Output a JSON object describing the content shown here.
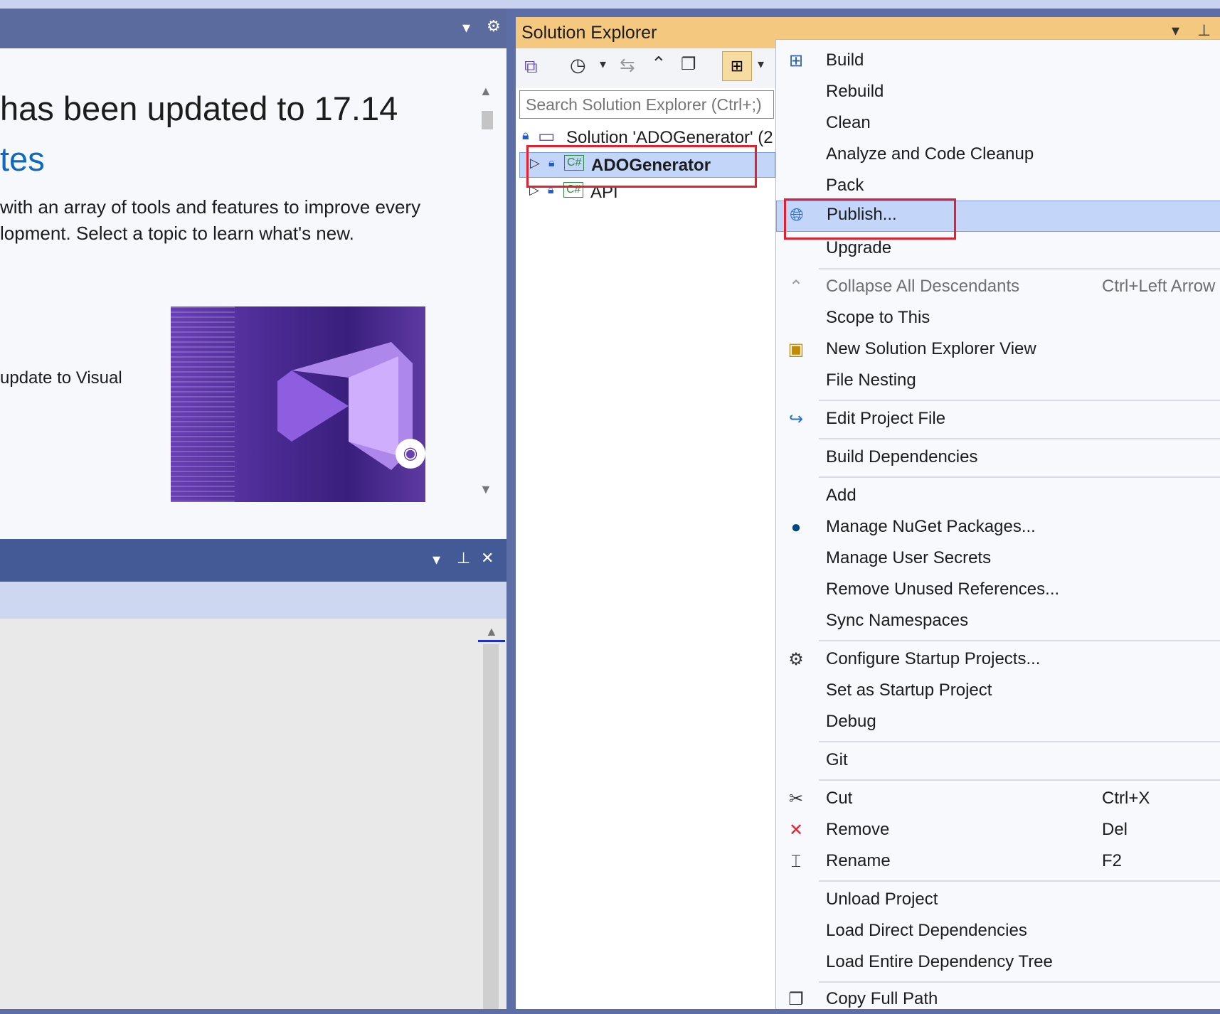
{
  "whats_new": {
    "heading": "has been updated to 17.14",
    "link": "tes",
    "para_line1": "with an array of tools and features to improve every",
    "para_line2": "lopment. Select a topic to learn what's new.",
    "side_text": "update to Visual"
  },
  "solution_explorer": {
    "title": "Solution Explorer",
    "search_placeholder": "Search Solution Explorer (Ctrl+;)",
    "solution_label": "Solution 'ADOGenerator' (2",
    "projects": [
      {
        "name": "ADOGenerator",
        "selected": true
      },
      {
        "name": "API",
        "selected": false
      }
    ]
  },
  "context_menu": {
    "items": [
      {
        "label": "Build",
        "icon": "build-icon"
      },
      {
        "label": "Rebuild"
      },
      {
        "label": "Clean"
      },
      {
        "label": "Analyze and Code Cleanup"
      },
      {
        "label": "Pack"
      },
      {
        "label": "Publish...",
        "icon": "publish-globe-icon",
        "highlighted": true
      },
      {
        "label": "Upgrade"
      },
      {
        "label": "Collapse All Descendants",
        "shortcut": "Ctrl+Left Arrow",
        "disabled": true,
        "icon": "chevron-up-icon"
      },
      {
        "label": "Scope to This"
      },
      {
        "label": "New Solution Explorer View",
        "icon": "new-window-icon"
      },
      {
        "label": "File Nesting"
      },
      {
        "label": "Edit Project File",
        "icon": "redo-arrow-icon"
      },
      {
        "label": "Build Dependencies"
      },
      {
        "label": "Add"
      },
      {
        "label": "Manage NuGet Packages...",
        "icon": "nuget-icon"
      },
      {
        "label": "Manage User Secrets"
      },
      {
        "label": "Remove Unused References..."
      },
      {
        "label": "Sync Namespaces"
      },
      {
        "label": "Configure Startup Projects...",
        "icon": "gear-icon"
      },
      {
        "label": "Set as Startup Project"
      },
      {
        "label": "Debug"
      },
      {
        "label": "Git"
      },
      {
        "label": "Cut",
        "shortcut": "Ctrl+X",
        "icon": "scissors-icon"
      },
      {
        "label": "Remove",
        "shortcut": "Del",
        "icon": "red-x-icon"
      },
      {
        "label": "Rename",
        "shortcut": "F2",
        "icon": "rename-icon"
      },
      {
        "label": "Unload Project"
      },
      {
        "label": "Load Direct Dependencies"
      },
      {
        "label": "Load Entire Dependency Tree"
      },
      {
        "label": "Copy Full Path",
        "icon": "copy-icon"
      }
    ]
  },
  "colors": {
    "accent": "#5c6ea5",
    "title_bar": "#f5c880",
    "highlight": "#c3d6fa",
    "annotation": "#e4202e",
    "link": "#1068bf"
  }
}
